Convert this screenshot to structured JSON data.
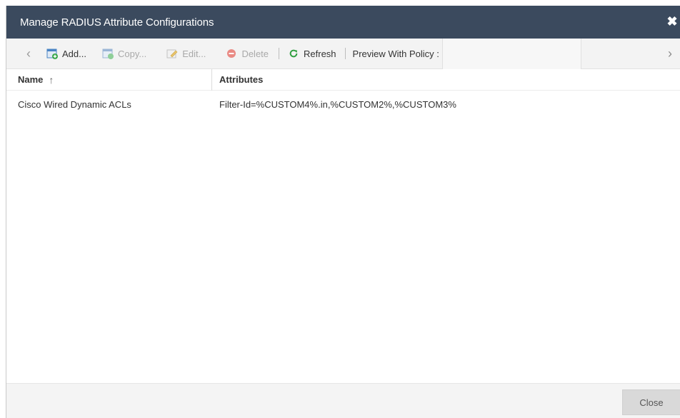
{
  "dialog": {
    "title": "Manage RADIUS Attribute Configurations",
    "close_icon": "close-icon"
  },
  "toolbar": {
    "nav_left_icon": "chevron-left-icon",
    "nav_right_icon": "chevron-right-icon",
    "add": {
      "label": "Add...",
      "icon": "add-icon",
      "enabled": true
    },
    "copy": {
      "label": "Copy...",
      "icon": "copy-icon",
      "enabled": false
    },
    "edit": {
      "label": "Edit...",
      "icon": "edit-icon",
      "enabled": false
    },
    "delete": {
      "label": "Delete",
      "icon": "delete-icon",
      "enabled": false
    },
    "refresh": {
      "label": "Refresh",
      "icon": "refresh-icon",
      "enabled": true
    },
    "preview_label": "Preview With Policy :",
    "preview_value": ""
  },
  "grid": {
    "columns": [
      {
        "label": "Name",
        "sort": "ascending"
      },
      {
        "label": "Attributes"
      }
    ],
    "rows": [
      {
        "name": "Cisco Wired Dynamic ACLs",
        "attributes": "Filter-Id=%CUSTOM4%.in,%CUSTOM2%,%CUSTOM3%"
      }
    ]
  },
  "footer": {
    "close_label": "Close"
  },
  "colors": {
    "titlebar": "#3b4a5e",
    "refresh_green": "#2e9e3e",
    "delete_red": "#e0534a",
    "add_blue": "#4a84c4"
  }
}
